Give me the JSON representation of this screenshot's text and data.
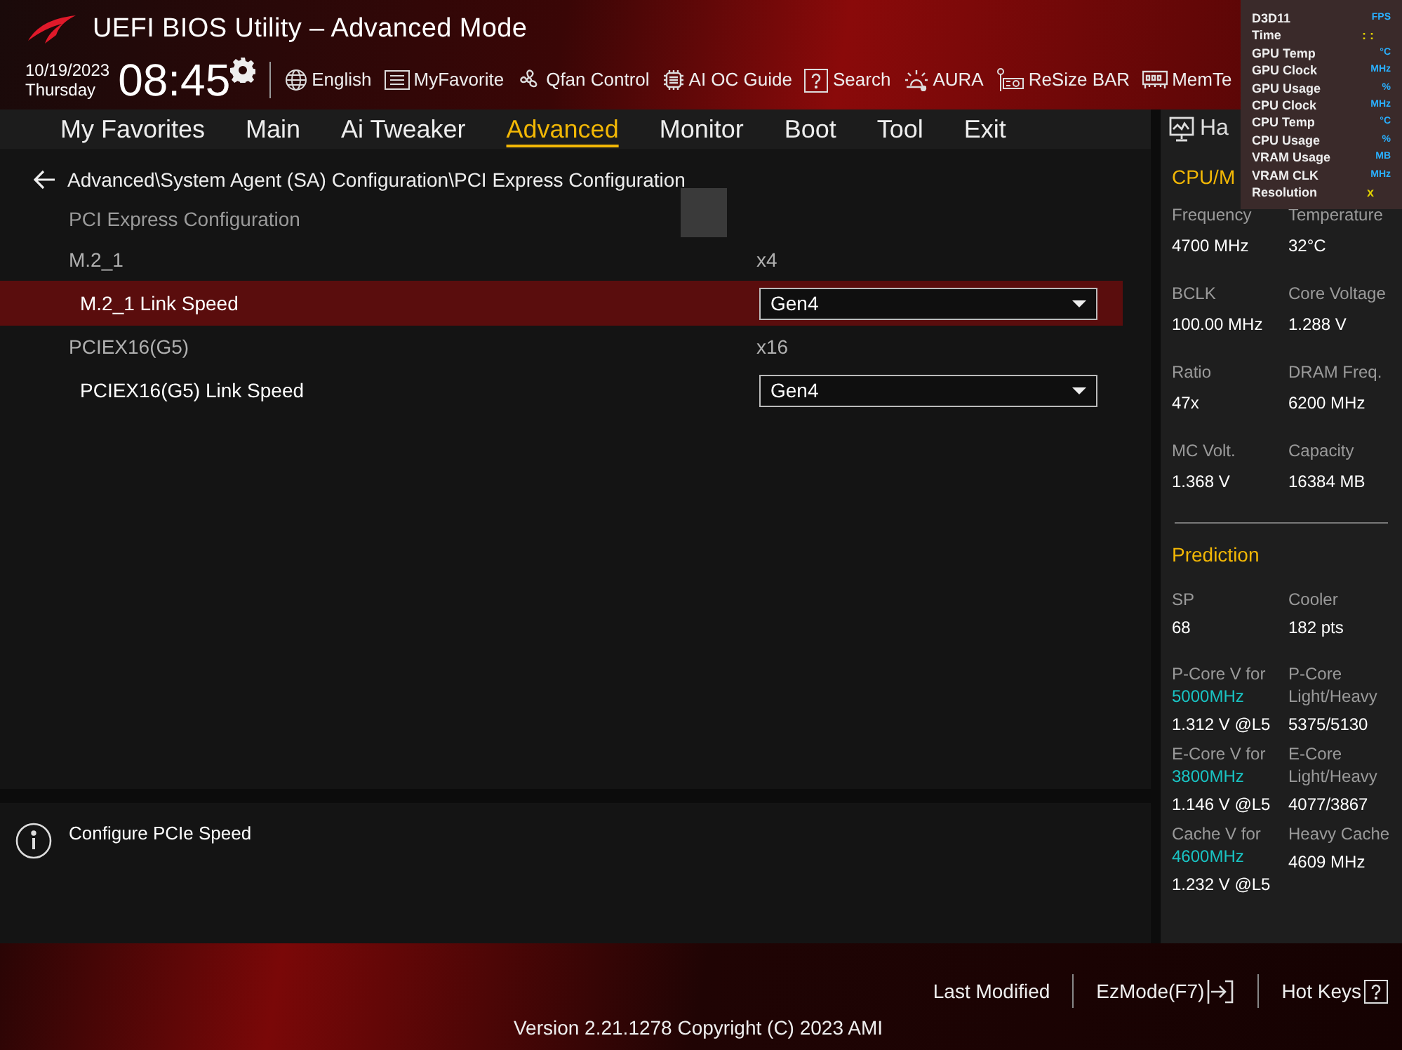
{
  "header": {
    "title": "UEFI BIOS Utility – Advanced Mode",
    "date": "10/19/2023",
    "day": "Thursday",
    "time": "08:45",
    "tools": [
      {
        "kind": "globe",
        "label": "English"
      },
      {
        "kind": "list",
        "label": "MyFavorite"
      },
      {
        "kind": "fan",
        "label": "Qfan Control"
      },
      {
        "kind": "chip",
        "label": "AI OC Guide"
      },
      {
        "kind": "help",
        "label": "Search"
      },
      {
        "kind": "aura",
        "label": "AURA"
      },
      {
        "kind": "card",
        "label": "ReSize BAR"
      },
      {
        "kind": "memory",
        "label": "MemTe"
      }
    ]
  },
  "tabs": [
    {
      "label": "My Favorites",
      "selected": false
    },
    {
      "label": "Main",
      "selected": false
    },
    {
      "label": "Ai Tweaker",
      "selected": false
    },
    {
      "label": "Advanced",
      "selected": true
    },
    {
      "label": "Monitor",
      "selected": false
    },
    {
      "label": "Boot",
      "selected": false
    },
    {
      "label": "Tool",
      "selected": false
    },
    {
      "label": "Exit",
      "selected": false
    }
  ],
  "breadcrumb": "Advanced\\System Agent (SA) Configuration\\PCI Express Configuration",
  "settings": [
    {
      "kind": "heading",
      "label": "PCI Express Configuration"
    },
    {
      "kind": "info",
      "label": "M.2_1",
      "value": "x4"
    },
    {
      "kind": "dropdown",
      "label": "M.2_1 Link Speed",
      "value": "Gen4",
      "selected": true
    },
    {
      "kind": "info",
      "label": "PCIEX16(G5)",
      "value": "x16"
    },
    {
      "kind": "dropdown",
      "label": "PCIEX16(G5) Link Speed",
      "value": "Gen4",
      "selected": false
    }
  ],
  "help_text": "Configure PCIe Speed",
  "hardware_monitor": {
    "title": "Ha",
    "section": "CPU/M",
    "stats": [
      {
        "label": "Frequency",
        "value": "4700 MHz"
      },
      {
        "label": "Temperature",
        "value": "32°C"
      },
      {
        "label": "BCLK",
        "value": "100.00 MHz"
      },
      {
        "label": "Core Voltage",
        "value": "1.288 V"
      },
      {
        "label": "Ratio",
        "value": "47x"
      },
      {
        "label": "DRAM Freq.",
        "value": "6200 MHz"
      },
      {
        "label": "MC Volt.",
        "value": "1.368 V"
      },
      {
        "label": "Capacity",
        "value": "16384 MB"
      }
    ],
    "prediction_title": "Prediction",
    "prediction": [
      {
        "label": "SP",
        "value": "68"
      },
      {
        "label": "Cooler",
        "value": "182 pts"
      },
      {
        "label": "P-Core V for",
        "highlight": "5000MHz",
        "value": "1.312 V @L5"
      },
      {
        "label": "P-Core Light/Heavy",
        "value": "5375/5130"
      },
      {
        "label": "E-Core V for",
        "highlight": "3800MHz",
        "value": "1.146 V @L5"
      },
      {
        "label": "E-Core Light/Heavy",
        "value": "4077/3867"
      },
      {
        "label": "Cache V for",
        "highlight": "4600MHz",
        "value": "1.232 V @L5"
      },
      {
        "label": "Heavy Cache",
        "value": "4609 MHz"
      }
    ]
  },
  "osd": [
    {
      "label": "D3D11",
      "unit": "FPS"
    },
    {
      "label": "Time",
      "unit": ": :"
    },
    {
      "label": "GPU Temp",
      "unit": "°C"
    },
    {
      "label": "GPU Clock",
      "unit": "MHz"
    },
    {
      "label": "GPU Usage",
      "unit": "%"
    },
    {
      "label": "CPU Clock",
      "unit": "MHz"
    },
    {
      "label": "CPU Temp",
      "unit": "°C"
    },
    {
      "label": "CPU Usage",
      "unit": "%"
    },
    {
      "label": "VRAM Usage",
      "unit": "MB"
    },
    {
      "label": "VRAM CLK",
      "unit": "MHz"
    },
    {
      "label": "Resolution",
      "unit": "x"
    }
  ],
  "footer": {
    "buttons": [
      {
        "kind": "text",
        "label": "Last Modified"
      },
      {
        "kind": "exit",
        "label": "EzMode(F7)"
      },
      {
        "kind": "help",
        "label": "Hot Keys"
      }
    ],
    "version": "Version 2.21.1278 Copyright (C) 2023 AMI"
  }
}
